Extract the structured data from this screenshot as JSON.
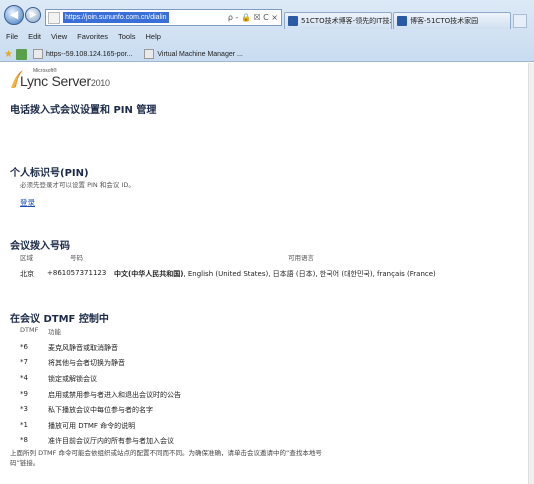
{
  "browser": {
    "address_url": "https://join.sununfo.com.cn/dialin",
    "address_tools": "ρ - 🔒 ☒ C ×",
    "tabs": [
      {
        "label": "51CTO技术博客-领先的IT技术..."
      },
      {
        "label": "博客-51CTO技术家园"
      }
    ],
    "menu": [
      "File",
      "Edit",
      "View",
      "Favorites",
      "Tools",
      "Help"
    ],
    "favorites": [
      {
        "label": "https--59.108.124.165-por..."
      },
      {
        "label": "Virtual Machine Manager ..."
      }
    ]
  },
  "page": {
    "logo": {
      "microsoft": "Microsoft®",
      "product": "Lync Server",
      "year": "2010"
    },
    "title": "电话拨入式会议设置和 PIN 管理",
    "pin": {
      "heading": "个人标识号(PIN)",
      "note": "必须先登录才可以设置 PIN 和会议 ID。",
      "login": "登录"
    },
    "dialin": {
      "heading": "会议拨入号码",
      "col_region": "区域",
      "col_number": "号码",
      "col_languages": "可用语言",
      "rows": [
        {
          "region": "北京",
          "number": "+861057371123",
          "primary_language": "中文(中华人民共和国)",
          "other_languages": ", English (United States), 日本語 (日本), 한국어 (대한민국), français (France)"
        }
      ]
    },
    "dtmf": {
      "heading": "在会议 DTMF 控制中",
      "col_dtmf": "DTMF",
      "col_function": "功能",
      "rows": [
        {
          "key": "*6",
          "desc": "麦克风静音或取消静音"
        },
        {
          "key": "*7",
          "desc": "将其他与会者切换为静音"
        },
        {
          "key": "*4",
          "desc": "锁定或解锁会议"
        },
        {
          "key": "*9",
          "desc": "启用或禁用参与者进入和退出会议时的公告"
        },
        {
          "key": "*3",
          "desc": "私下播放会议中每位参与者的名字"
        },
        {
          "key": "*1",
          "desc": "播放可用 DTMF 命令的说明"
        },
        {
          "key": "*8",
          "desc": "准许目前会议厅内的所有参与者加入会议"
        }
      ]
    },
    "footer": "上面所列 DTMF 命令可能会依组织或站点的配置不同而不同。为确保准确，请单击会议邀请中的“查找本地号码”链接。"
  }
}
